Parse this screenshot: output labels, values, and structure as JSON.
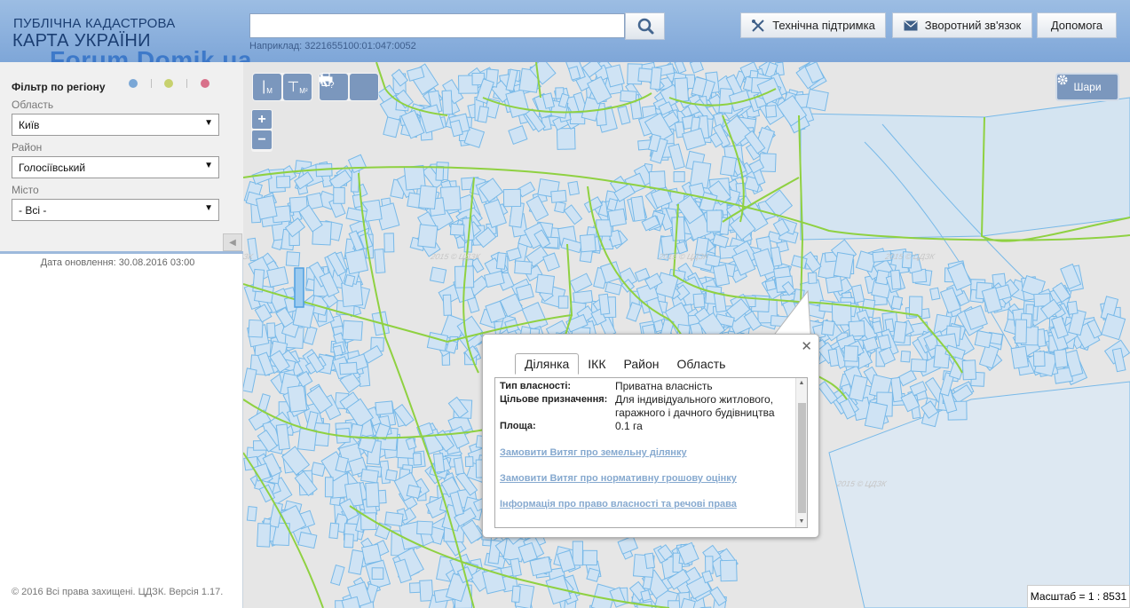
{
  "header": {
    "logo_line1": "ПУБЛІЧНА КАДАСТРОВА",
    "logo_line2": "КАРТА УКРАЇНИ",
    "watermark": "Forum.Domik.ua",
    "search": {
      "value": "",
      "placeholder": "",
      "hint": "Наприклад: 3221655100:01:047:0052",
      "icon": "search-icon"
    },
    "buttons": {
      "support": {
        "label": "Технічна підтримка",
        "icon": "tools-icon"
      },
      "feedback": {
        "label": "Зворотний зв'язок",
        "icon": "envelope-icon"
      },
      "help": {
        "label": "Допомога"
      }
    }
  },
  "filter": {
    "title": "Фільтр по регіону",
    "dots": [
      "#7aa7d6",
      "#c7d16e",
      "#d8708a"
    ],
    "oblast": {
      "label": "Область",
      "value": "Київ"
    },
    "rayon": {
      "label": "Район",
      "value": "Голосіївський"
    },
    "misto": {
      "label": "Місто",
      "value": "- Всі -"
    },
    "update_date": "Дата оновлення: 30.08.2016 03:00",
    "copyright": "© 2016 Всі права захищені. ЦДЗК. Версія 1.17."
  },
  "map": {
    "toolbar": {
      "measure_line": "М",
      "measure_area": "М²",
      "print_icon": "print-icon",
      "identify_icon": "cursor-question-icon"
    },
    "zoom_in": "+",
    "zoom_out": "−",
    "layers_label": "Шари",
    "scale": "Масштаб = 1 : 8531",
    "watermark_text": "2015 © ЦДЗК",
    "colors": {
      "background": "#e6e6e6",
      "parcel_stroke": "#78b9e8",
      "parcel_fill": "#cfe3f4",
      "boundary": "#8fd141"
    }
  },
  "popup": {
    "tabs": [
      "Ділянка",
      "ІКК",
      "Район",
      "Область"
    ],
    "active_tab": "Ділянка",
    "fields": [
      {
        "key": "Тип власності:",
        "value": "Приватна власність"
      },
      {
        "key": "Цільове призначення:",
        "value": "Для індивідуального житлового, гаражного і дачного будівництва"
      },
      {
        "key": "Площа:",
        "value": "0.1 га"
      }
    ],
    "links": [
      "Замовити Витяг про земельну ділянку",
      "Замовити Витяг про нормативну грошову оцінку",
      "Інформація про право власності та речові права"
    ]
  }
}
